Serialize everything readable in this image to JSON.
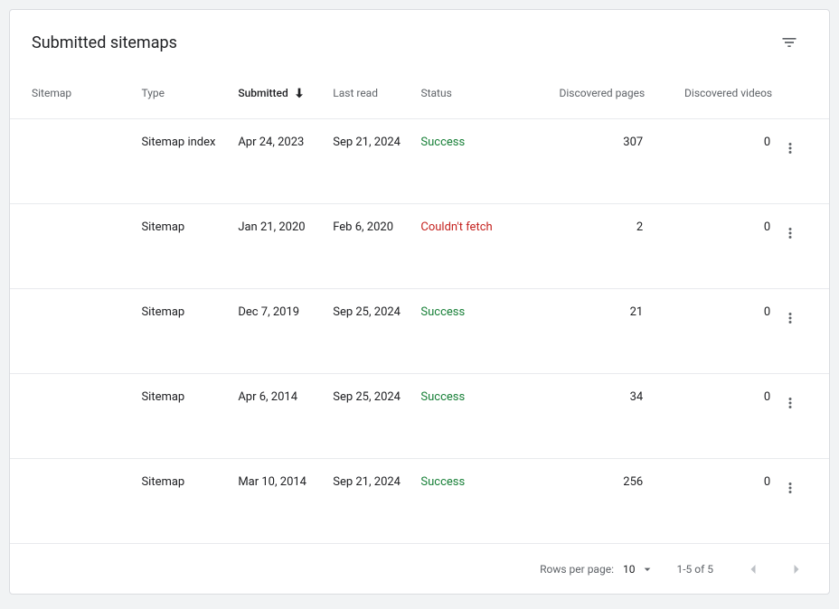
{
  "header": {
    "title": "Submitted sitemaps"
  },
  "columns": {
    "sitemap": "Sitemap",
    "type": "Type",
    "submitted": "Submitted",
    "last_read": "Last read",
    "status": "Status",
    "discovered_pages": "Discovered pages",
    "discovered_videos": "Discovered videos"
  },
  "rows": [
    {
      "sitemap": "",
      "type": "Sitemap index",
      "submitted": "Apr 24, 2023",
      "last_read": "Sep 21, 2024",
      "status": "Success",
      "status_class": "success",
      "pages": "307",
      "videos": "0"
    },
    {
      "sitemap": "",
      "type": "Sitemap",
      "submitted": "Jan 21, 2020",
      "last_read": "Feb 6, 2020",
      "status": "Couldn't fetch",
      "status_class": "error",
      "pages": "2",
      "videos": "0"
    },
    {
      "sitemap": "",
      "type": "Sitemap",
      "submitted": "Dec 7, 2019",
      "last_read": "Sep 25, 2024",
      "status": "Success",
      "status_class": "success",
      "pages": "21",
      "videos": "0"
    },
    {
      "sitemap": "",
      "type": "Sitemap",
      "submitted": "Apr 6, 2014",
      "last_read": "Sep 25, 2024",
      "status": "Success",
      "status_class": "success",
      "pages": "34",
      "videos": "0"
    },
    {
      "sitemap": "",
      "type": "Sitemap",
      "submitted": "Mar 10, 2014",
      "last_read": "Sep 21, 2024",
      "status": "Success",
      "status_class": "success",
      "pages": "256",
      "videos": "0"
    }
  ],
  "pagination": {
    "rows_per_page_label": "Rows per page:",
    "rows_per_page_value": "10",
    "range_text": "1-5 of 5"
  }
}
